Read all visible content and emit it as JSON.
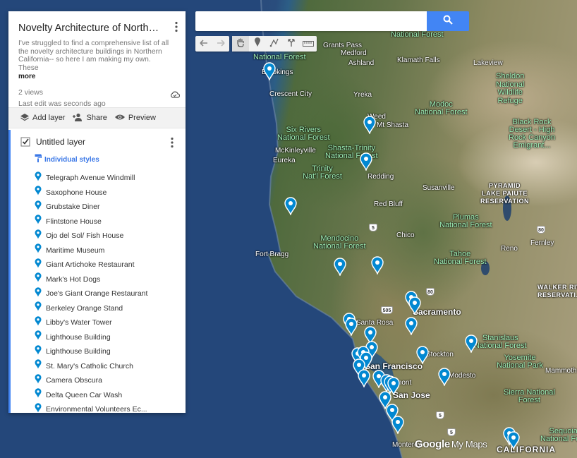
{
  "search": {
    "placeholder": ""
  },
  "panel": {
    "title": "Novelty Architecture of Northern ...",
    "description": "I've struggled to find a comprehensive list of all the novelty architecture buildings in Northern California-- so here I am making my own. These",
    "more": "more",
    "views": "2 views",
    "last_edit": "Last edit was seconds ago",
    "actions": {
      "add_layer": "Add layer",
      "share": "Share",
      "preview": "Preview"
    },
    "layer": {
      "title": "Untitled layer",
      "style": "Individual styles",
      "places": [
        "Telegraph Avenue Windmill",
        "Saxophone House",
        "Grubstake Diner",
        "Flintstone House",
        "Ojo del Sol/ Fish House",
        "Maritime Museum",
        "Giant Artichoke Restaurant",
        "Mark's Hot Dogs",
        "Joe's Giant Orange Restaurant",
        "Berkeley Orange Stand",
        "Libby's Water Tower",
        "Lighthouse Building",
        "Lighthouse Building",
        "St. Mary's Catholic Church",
        "Camera Obscura",
        "Delta Queen Car Wash",
        "Environmental Volunteers Ec..."
      ]
    }
  },
  "map": {
    "labels": {
      "brookings": "Brookings",
      "crescent_city": "Crescent City",
      "medford": "Medford",
      "ashland": "Ashland",
      "klamath_falls": "Klamath Falls",
      "lakeview": "Lakeview",
      "grants_pass": "Grants Pass",
      "yreka": "Yreka",
      "weed": "Weed",
      "mt_shasta": "Mt Shasta",
      "mckinleyville": "McKinleyville",
      "eureka": "Eureka",
      "redding": "Redding",
      "red_bluff": "Red Bluff",
      "susanville": "Susanville",
      "chico": "Chico",
      "fort_bragg": "Fort Bragg",
      "reno": "Reno",
      "fernley": "Fernley",
      "santa_rosa": "Santa Rosa",
      "sacramento": "Sacramento",
      "stockton": "Stockton",
      "modesto": "Modesto",
      "san_francisco": "San Francisco",
      "san_jose": "San Jose",
      "fremont": "Fremont",
      "monterey": "Monterey",
      "mammoth": "Mammoth Lakes",
      "california": "CALIFORNIA",
      "nf_siskiyou": "National Forest",
      "nf_rogue": "National Forest",
      "sheldon": "Sheldon\nNational\nWildlife\nRefuge",
      "modoc": "Modoc\nNational Forest",
      "black_rock": "Black Rock\nDesert - High\nRock Canyon\nEmigrant...",
      "six_rivers": "Six Rivers\nNational Forest",
      "shasta_trinity": "Shasta-Trinity\nNational Forest",
      "trinity_nf": "Trinity\nNat'l Forest",
      "pyramid": "PYRAMID\nLAKE PAIUTE\nRESERVATION",
      "plumas": "Plumas\nNational Forest",
      "mendocino": "Mendocino\nNational Forest",
      "tahoe": "Tahoe\nNational Forest",
      "walker_river": "WALKER RIV\nRESERVATI...",
      "stanislaus": "Stanislaus\nNational Forest",
      "yosemite": "Yosemite\nNational Park",
      "sierra": "Sierra National\nForest",
      "sequoia": "Sequoia\nNational Fo..."
    },
    "shields": [
      "5",
      "5",
      "80",
      "80",
      "505",
      "5",
      "5",
      "80"
    ],
    "logo_brand": "Google",
    "logo_product": "My Maps"
  },
  "colors": {
    "marker": "#0288d1",
    "accent": "#4285f4",
    "forest_label": "#9ff0b7"
  }
}
